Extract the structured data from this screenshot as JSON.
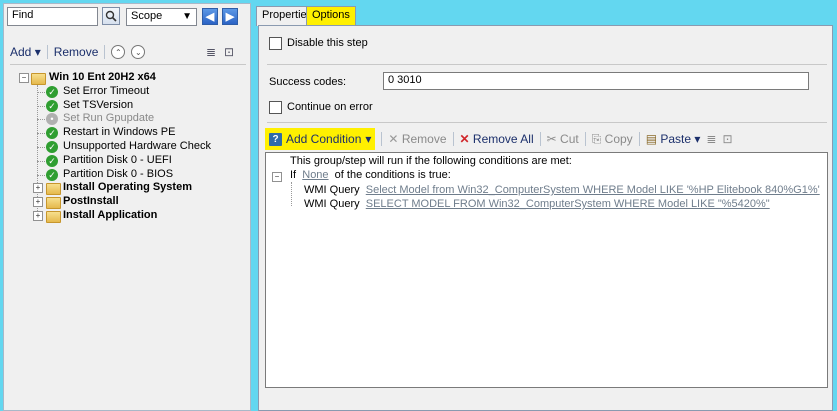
{
  "find": {
    "value": "Find"
  },
  "scope": {
    "label": "Scope"
  },
  "left_toolbar": {
    "add_label": "Add",
    "remove_label": "Remove"
  },
  "tree": {
    "root": "Win 10 Ent 20H2 x64",
    "steps": [
      {
        "label": "Set Error Timeout",
        "enabled": true
      },
      {
        "label": "Set TSVersion",
        "enabled": true
      },
      {
        "label": "Set Run Gpupdate",
        "enabled": false
      },
      {
        "label": "Restart in Windows PE",
        "enabled": true
      },
      {
        "label": "Unsupported Hardware Check",
        "enabled": true,
        "selected": true
      },
      {
        "label": "Partition Disk 0 - UEFI",
        "enabled": true
      },
      {
        "label": "Partition Disk 0 - BIOS",
        "enabled": true
      }
    ],
    "groups": [
      "Install Operating System",
      "PostInstall",
      "Install Application"
    ]
  },
  "tabs": {
    "properties": "Properties",
    "options": "Options"
  },
  "options": {
    "disable_step": "Disable this step",
    "success_codes_label": "Success codes:",
    "success_codes_value": "0 3010",
    "continue_on_error": "Continue on error"
  },
  "cond_toolbar": {
    "add_condition": "Add Condition",
    "remove": "Remove",
    "remove_all": "Remove All",
    "cut": "Cut",
    "copy": "Copy",
    "paste": "Paste"
  },
  "conditions": {
    "intro": "This group/step will run if the following conditions are met:",
    "if_word": "If",
    "none_link": "None",
    "if_suffix": "of the conditions is true:",
    "items": [
      {
        "type": "WMI Query",
        "query": "Select Model from Win32_ComputerSystem WHERE Model LIKE '%HP Elitebook 840%G1%'"
      },
      {
        "type": "WMI Query",
        "query": "SELECT MODEL FROM Win32_ComputerSystem WHERE Model LIKE \"%5420%\""
      }
    ]
  },
  "colors": {
    "highlight": "#fff000",
    "background": "#63d7f0",
    "success": "#2f9e31",
    "remove_all": "#d0262a"
  },
  "icons": [
    "search-icon",
    "back-arrow-icon",
    "forward-arrow-icon",
    "move-up-icon",
    "move-down-icon",
    "properties-icon",
    "help-icon",
    "folder-icon",
    "success-check-icon",
    "delete-icon",
    "cut-icon",
    "copy-icon",
    "paste-icon"
  ]
}
